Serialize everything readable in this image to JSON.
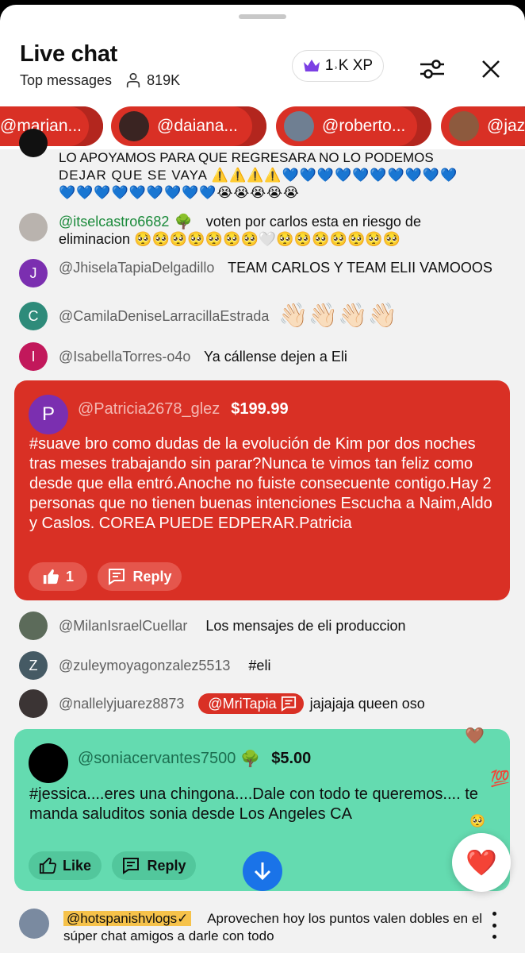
{
  "header": {
    "title": "Live chat",
    "subtitle": "Top messages",
    "viewers": "819K",
    "xp_label": "1˒K XP",
    "filter_icon": "sliders-icon",
    "close_icon": "close-icon"
  },
  "chips": [
    {
      "name": "@marian..."
    },
    {
      "name": "@daiana..."
    },
    {
      "name": "@roberto..."
    },
    {
      "name": "@jaz"
    }
  ],
  "messages": {
    "m0": {
      "line1": "LO APOYAMOS PARA QUE REGRESARA NO LO PODEMOS",
      "line2": "DEJAR QUE SE VAYA ⚠️⚠️⚠️⚠️💙💙💙💙💙💙💙💙💙💙",
      "line3": "💙💙💙💙💙💙💙💙💙😭😭😭😭😭"
    },
    "m1": {
      "author": "@itselcastro6682",
      "badge": "🌳",
      "text": "voten por carlos esta en riesgo de eliminacion 🥺🥺🥺🥺🥺🥺🥺🤍🥺🥺🥺🥺🥺🥺🥺"
    },
    "m2": {
      "initial": "J",
      "author": "@JhiselaTapiaDelgadillo",
      "text": "TEAM CARLOS Y TEAM ELII VAMOOOS"
    },
    "m3": {
      "initial": "C",
      "author": "@CamilaDeniseLarracillaEstrada",
      "text": "👋🏻👋🏻👋🏻👋🏻"
    },
    "m4": {
      "initial": "I",
      "author": "@IsabellaTorres-o4o",
      "text": "Ya cállense dejen a Eli"
    },
    "m6": {
      "author": "@MilanIsraelCuellar",
      "text": "Los mensajes de eli produccion"
    },
    "m7": {
      "initial": "Z",
      "author": "@zuleymoyagonzalez5513",
      "text": "#eli"
    },
    "m8": {
      "author": "@nallelyjuarez8873",
      "mention": "@MriTapia",
      "text": "jajajaja queen oso"
    }
  },
  "superchat_red": {
    "initial": "P",
    "author": "@Patricia2678_glez",
    "amount": "$199.99",
    "text": "#suave bro como dudas de la evolución de Kim por dos noches tras meses trabajando sin parar?Nunca te vimos tan feliz como desde que ella entró.Anoche no fuiste consecuente contigo.Hay 2 personas que no tienen buenas intenciones Escucha a Naim,Aldo y Caslos. COREA PUEDE EDPERAR.Patricia",
    "likes": "1",
    "reply_label": "Reply"
  },
  "superchat_green": {
    "author": "@soniacervantes7500",
    "badge": "🌳",
    "amount": "$5.00",
    "text": "#jessica....eres una chingona....Dale con todo te queremos.... te manda saluditos sonia desde Los Angeles CA",
    "like_label": "Like",
    "reply_label": "Reply"
  },
  "pinned": {
    "handle": "@hotspanishvlogs✓",
    "text": "Aprovechen hoy los puntos valen dobles en el súper chat amigos a darle con todo"
  },
  "colors": {
    "superchat_red": "#d93025",
    "superchat_green": "#64dbb0",
    "accent_blue": "#1a73e8",
    "pinned_handle_bg": "#f6c24a"
  }
}
